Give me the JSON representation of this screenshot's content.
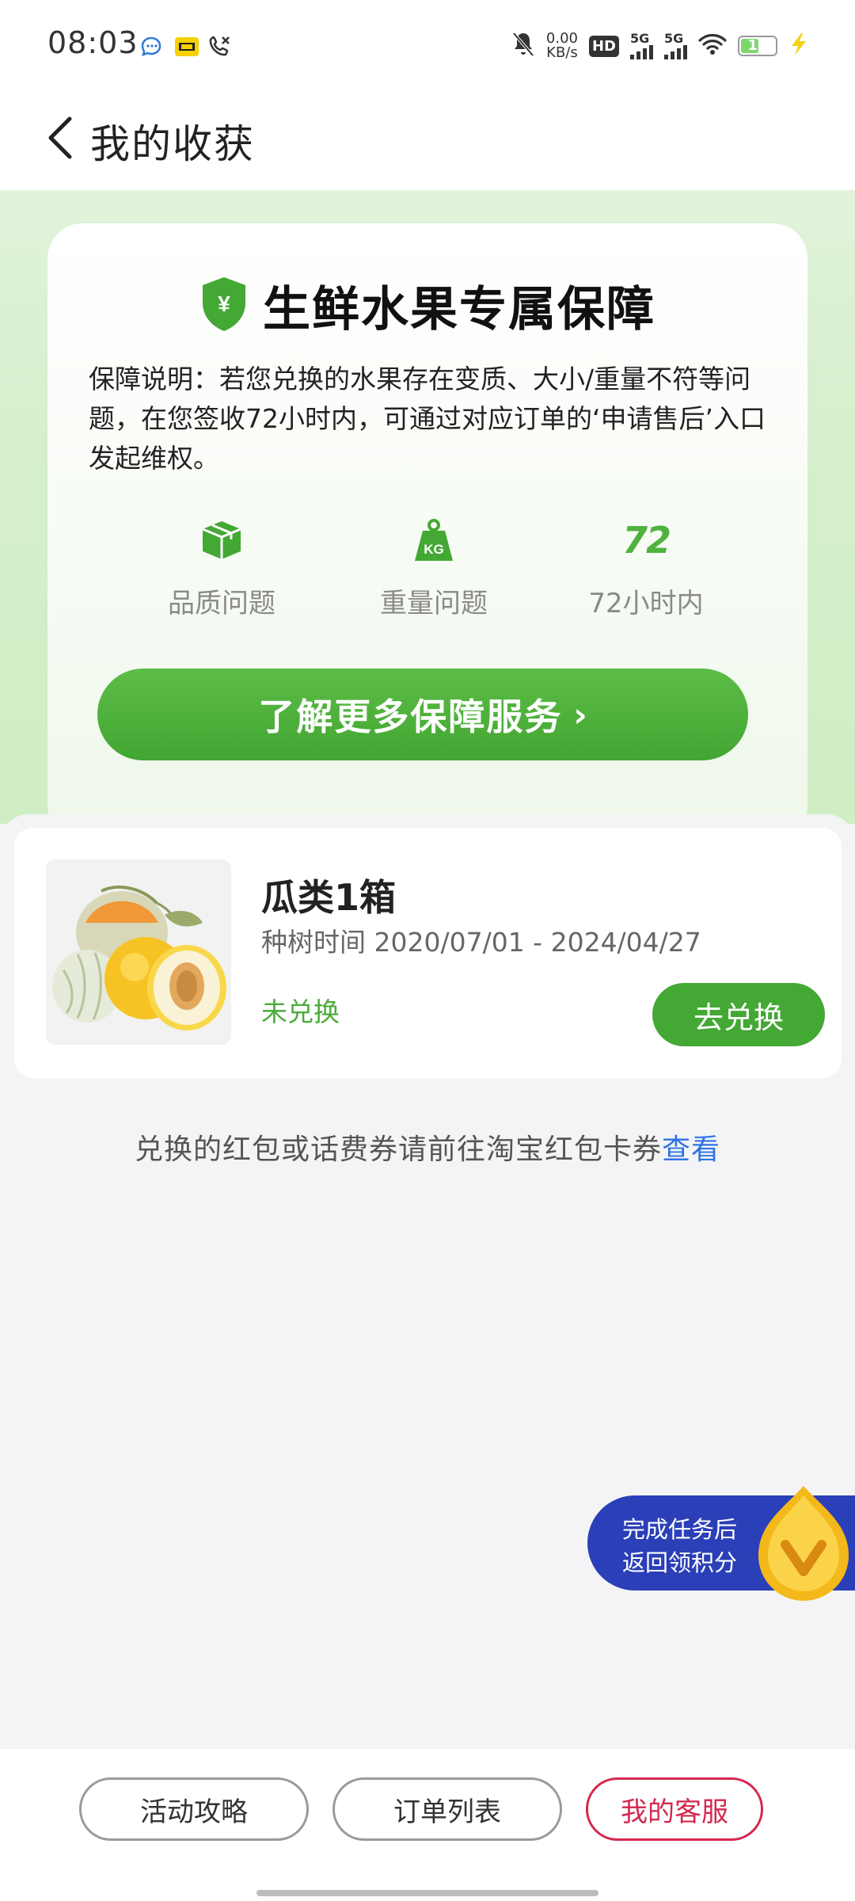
{
  "status_bar": {
    "time": "08:03",
    "net_speed_value": "0.00",
    "net_speed_unit": "KB/s",
    "hd_label": "HD",
    "sim1": "5G",
    "sim2": "5G",
    "battery": "19"
  },
  "header": {
    "title": "我的收获"
  },
  "guarantee": {
    "title": "生鲜水果专属保障",
    "shield_symbol": "¥",
    "description": "保障说明：若您兑换的水果存在变质、大小/重量不符等问题，在您签收72小时内，可通过对应订单的‘申请售后’入口发起维权。",
    "features": [
      {
        "icon": "box-icon",
        "label": "品质问题"
      },
      {
        "icon": "kg-weight-icon",
        "badge": "KG",
        "label": "重量问题"
      },
      {
        "icon": "72-hours-icon",
        "badge": "72",
        "label": "72小时内"
      }
    ],
    "more_button": "了解更多保障服务",
    "more_chevron": "›"
  },
  "prize": {
    "name": "瓜类1箱",
    "plant_time": "种树时间 2020/07/01 - 2024/04/27",
    "status": "未兑换",
    "redeem_button": "去兑换"
  },
  "note": {
    "text": "兑换的红包或话费券请前往淘宝红包卡券",
    "link": "查看"
  },
  "task_pill": {
    "line1": "完成任务后",
    "line2": "返回领积分"
  },
  "bottom_bar": {
    "guide": "活动攻略",
    "orders": "订单列表",
    "service": "我的客服"
  },
  "colors": {
    "accent_green": "#43a834",
    "link_blue": "#2e73e6",
    "service_red": "#d4284e",
    "task_blue": "#2b3fb8"
  }
}
